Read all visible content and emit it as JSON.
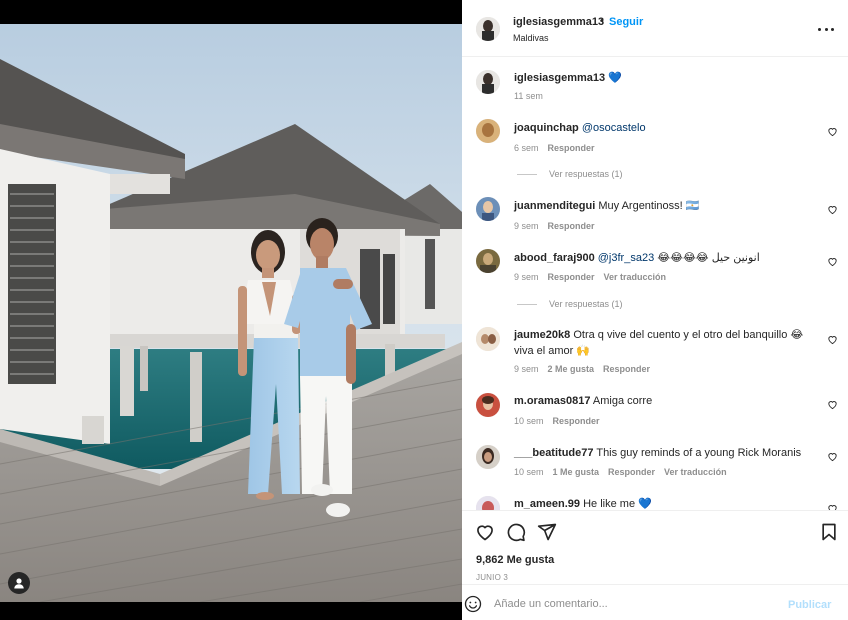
{
  "post": {
    "username": "iglesiasgemma13",
    "follow_label": "Seguir",
    "separator": "•",
    "location": "Maldivas",
    "caption_emoji": "💙",
    "caption_time": "11 sem"
  },
  "comments": [
    {
      "username": "joaquinchap",
      "text": "@osocastelo",
      "mention": true,
      "time": "6 sem",
      "reply_label": "Responder",
      "view_replies": "Ver respuestas (1)"
    },
    {
      "username": "juanmenditegui",
      "text": "Muy Argentinoss! 🇦🇷",
      "time": "9 sem",
      "reply_label": "Responder"
    },
    {
      "username": "abood_faraj900",
      "mention_text": "@j3fr_sa23",
      "text": "😂😂😂😂 انونين حيل",
      "time": "9 sem",
      "reply_label": "Responder",
      "translate_label": "Ver traducción",
      "view_replies": "Ver respuestas (1)"
    },
    {
      "username": "jaume20k8",
      "text": "Otra q vive del cuento y el otro del banquillo 😂 viva el amor 🙌",
      "time": "9 sem",
      "likes": "2 Me gusta",
      "reply_label": "Responder"
    },
    {
      "username": "m.oramas0817",
      "text": "Amiga corre",
      "time": "10 sem",
      "reply_label": "Responder"
    },
    {
      "username": "___beatitude77",
      "text": "This guy reminds of a young Rick Moranis",
      "time": "10 sem",
      "likes": "1 Me gusta",
      "reply_label": "Responder",
      "translate_label": "Ver traducción"
    },
    {
      "username": "m_ameen.99",
      "text": "He like me 💙"
    }
  ],
  "footer": {
    "likes": "9,862 Me gusta",
    "date": "JUNIO 3",
    "comment_placeholder": "Añade un comentario...",
    "publish_label": "Publicar"
  },
  "colors": {
    "accent": "#0095f6",
    "text": "#262626",
    "muted": "#8e8e8e",
    "publish_disabled": "#b2dffc"
  }
}
